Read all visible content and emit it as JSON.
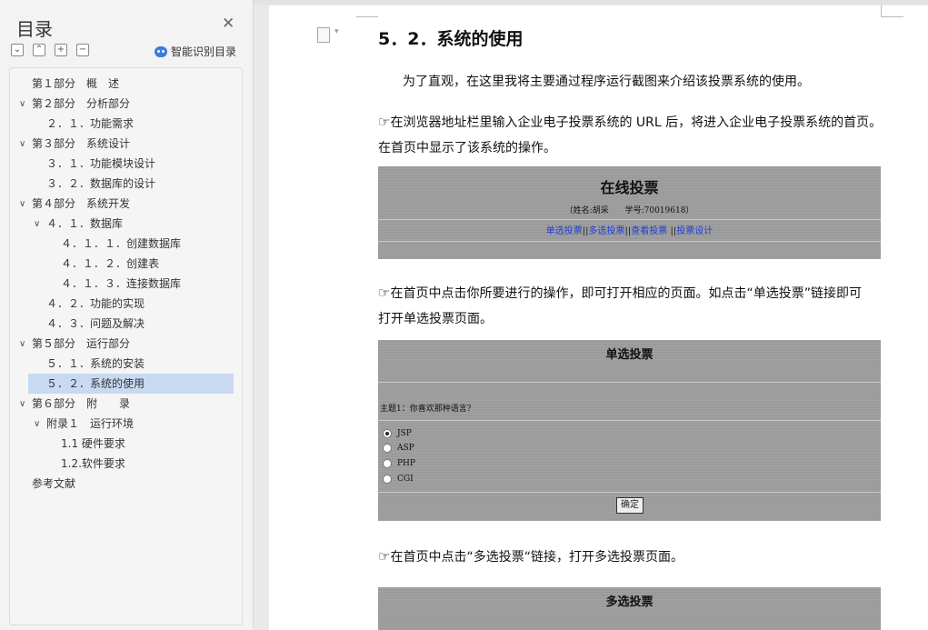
{
  "sidebar": {
    "title": "目录",
    "smart_label": "智能识别目录",
    "items": [
      {
        "label": "第１部分　概　述"
      },
      {
        "label": "第２部分　分析部分"
      },
      {
        "label": "２．１．功能需求"
      },
      {
        "label": "第３部分　系统设计"
      },
      {
        "label": "３．１．功能模块设计"
      },
      {
        "label": "３．２．数据库的设计"
      },
      {
        "label": "第４部分　系统开发"
      },
      {
        "label": "４．１．数据库"
      },
      {
        "label": "４．１．１．创建数据库"
      },
      {
        "label": "４．１．２．创建表"
      },
      {
        "label": "４．１．３．连接数据库"
      },
      {
        "label": "４．２．功能的实现"
      },
      {
        "label": "４．３．问题及解决"
      },
      {
        "label": "第５部分　运行部分"
      },
      {
        "label": "５．１．系统的安装"
      },
      {
        "label": "５．２．系统的使用"
      },
      {
        "label": "第６部分　附　　录"
      },
      {
        "label": "附录１　运行环境"
      },
      {
        "label": "1.1 硬件要求"
      },
      {
        "label": "1.2.软件要求"
      },
      {
        "label": "参考文献"
      }
    ]
  },
  "document": {
    "heading": "5．2．系统的使用",
    "para1": "为了直观，在这里我将主要通过程序运行截图来介绍该投票系统的使用。",
    "hand_glyph": "☞",
    "para2a": "在浏览器地址栏里输入企业电子投票系统的 URL 后，将进入企业电子投票系统的首页。",
    "para2b": "在首页中显示了该系统的操作。",
    "para3a": "在首页中点击你所要进行的操作，即可打开相应的页面。如点击“单选投票”链接即可",
    "para3b": "打开单选投票页面。",
    "para4": "在首页中点击“多选投票“链接，打开多选投票页面。"
  },
  "shot1": {
    "title": "在线投票",
    "subtitle": "（姓名:胡采　　学号:70019618）",
    "links": [
      "单选投票",
      "多选投票",
      "查看投票",
      "投票设计"
    ],
    "sep": "||"
  },
  "shot2": {
    "title": "单选投票",
    "topic": "主题1：你喜欢那种语言？",
    "options": [
      "JSP",
      "ASP",
      "PHP",
      "CGI"
    ],
    "selected": 0,
    "button": "确定"
  },
  "shot3": {
    "title": "多选投票"
  }
}
